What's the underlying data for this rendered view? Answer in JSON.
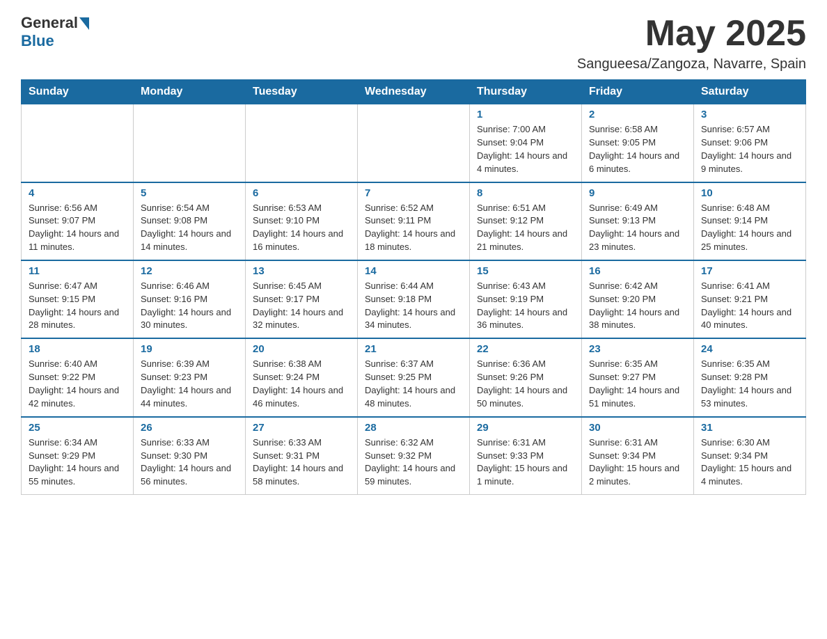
{
  "header": {
    "logo_text": "General",
    "logo_blue": "Blue",
    "title": "May 2025",
    "location": "Sangueesa/Zangoza, Navarre, Spain"
  },
  "days_of_week": [
    "Sunday",
    "Monday",
    "Tuesday",
    "Wednesday",
    "Thursday",
    "Friday",
    "Saturday"
  ],
  "weeks": [
    [
      {
        "day": "",
        "sunrise": "",
        "sunset": "",
        "daylight": ""
      },
      {
        "day": "",
        "sunrise": "",
        "sunset": "",
        "daylight": ""
      },
      {
        "day": "",
        "sunrise": "",
        "sunset": "",
        "daylight": ""
      },
      {
        "day": "",
        "sunrise": "",
        "sunset": "",
        "daylight": ""
      },
      {
        "day": "1",
        "sunrise": "Sunrise: 7:00 AM",
        "sunset": "Sunset: 9:04 PM",
        "daylight": "Daylight: 14 hours and 4 minutes."
      },
      {
        "day": "2",
        "sunrise": "Sunrise: 6:58 AM",
        "sunset": "Sunset: 9:05 PM",
        "daylight": "Daylight: 14 hours and 6 minutes."
      },
      {
        "day": "3",
        "sunrise": "Sunrise: 6:57 AM",
        "sunset": "Sunset: 9:06 PM",
        "daylight": "Daylight: 14 hours and 9 minutes."
      }
    ],
    [
      {
        "day": "4",
        "sunrise": "Sunrise: 6:56 AM",
        "sunset": "Sunset: 9:07 PM",
        "daylight": "Daylight: 14 hours and 11 minutes."
      },
      {
        "day": "5",
        "sunrise": "Sunrise: 6:54 AM",
        "sunset": "Sunset: 9:08 PM",
        "daylight": "Daylight: 14 hours and 14 minutes."
      },
      {
        "day": "6",
        "sunrise": "Sunrise: 6:53 AM",
        "sunset": "Sunset: 9:10 PM",
        "daylight": "Daylight: 14 hours and 16 minutes."
      },
      {
        "day": "7",
        "sunrise": "Sunrise: 6:52 AM",
        "sunset": "Sunset: 9:11 PM",
        "daylight": "Daylight: 14 hours and 18 minutes."
      },
      {
        "day": "8",
        "sunrise": "Sunrise: 6:51 AM",
        "sunset": "Sunset: 9:12 PM",
        "daylight": "Daylight: 14 hours and 21 minutes."
      },
      {
        "day": "9",
        "sunrise": "Sunrise: 6:49 AM",
        "sunset": "Sunset: 9:13 PM",
        "daylight": "Daylight: 14 hours and 23 minutes."
      },
      {
        "day": "10",
        "sunrise": "Sunrise: 6:48 AM",
        "sunset": "Sunset: 9:14 PM",
        "daylight": "Daylight: 14 hours and 25 minutes."
      }
    ],
    [
      {
        "day": "11",
        "sunrise": "Sunrise: 6:47 AM",
        "sunset": "Sunset: 9:15 PM",
        "daylight": "Daylight: 14 hours and 28 minutes."
      },
      {
        "day": "12",
        "sunrise": "Sunrise: 6:46 AM",
        "sunset": "Sunset: 9:16 PM",
        "daylight": "Daylight: 14 hours and 30 minutes."
      },
      {
        "day": "13",
        "sunrise": "Sunrise: 6:45 AM",
        "sunset": "Sunset: 9:17 PM",
        "daylight": "Daylight: 14 hours and 32 minutes."
      },
      {
        "day": "14",
        "sunrise": "Sunrise: 6:44 AM",
        "sunset": "Sunset: 9:18 PM",
        "daylight": "Daylight: 14 hours and 34 minutes."
      },
      {
        "day": "15",
        "sunrise": "Sunrise: 6:43 AM",
        "sunset": "Sunset: 9:19 PM",
        "daylight": "Daylight: 14 hours and 36 minutes."
      },
      {
        "day": "16",
        "sunrise": "Sunrise: 6:42 AM",
        "sunset": "Sunset: 9:20 PM",
        "daylight": "Daylight: 14 hours and 38 minutes."
      },
      {
        "day": "17",
        "sunrise": "Sunrise: 6:41 AM",
        "sunset": "Sunset: 9:21 PM",
        "daylight": "Daylight: 14 hours and 40 minutes."
      }
    ],
    [
      {
        "day": "18",
        "sunrise": "Sunrise: 6:40 AM",
        "sunset": "Sunset: 9:22 PM",
        "daylight": "Daylight: 14 hours and 42 minutes."
      },
      {
        "day": "19",
        "sunrise": "Sunrise: 6:39 AM",
        "sunset": "Sunset: 9:23 PM",
        "daylight": "Daylight: 14 hours and 44 minutes."
      },
      {
        "day": "20",
        "sunrise": "Sunrise: 6:38 AM",
        "sunset": "Sunset: 9:24 PM",
        "daylight": "Daylight: 14 hours and 46 minutes."
      },
      {
        "day": "21",
        "sunrise": "Sunrise: 6:37 AM",
        "sunset": "Sunset: 9:25 PM",
        "daylight": "Daylight: 14 hours and 48 minutes."
      },
      {
        "day": "22",
        "sunrise": "Sunrise: 6:36 AM",
        "sunset": "Sunset: 9:26 PM",
        "daylight": "Daylight: 14 hours and 50 minutes."
      },
      {
        "day": "23",
        "sunrise": "Sunrise: 6:35 AM",
        "sunset": "Sunset: 9:27 PM",
        "daylight": "Daylight: 14 hours and 51 minutes."
      },
      {
        "day": "24",
        "sunrise": "Sunrise: 6:35 AM",
        "sunset": "Sunset: 9:28 PM",
        "daylight": "Daylight: 14 hours and 53 minutes."
      }
    ],
    [
      {
        "day": "25",
        "sunrise": "Sunrise: 6:34 AM",
        "sunset": "Sunset: 9:29 PM",
        "daylight": "Daylight: 14 hours and 55 minutes."
      },
      {
        "day": "26",
        "sunrise": "Sunrise: 6:33 AM",
        "sunset": "Sunset: 9:30 PM",
        "daylight": "Daylight: 14 hours and 56 minutes."
      },
      {
        "day": "27",
        "sunrise": "Sunrise: 6:33 AM",
        "sunset": "Sunset: 9:31 PM",
        "daylight": "Daylight: 14 hours and 58 minutes."
      },
      {
        "day": "28",
        "sunrise": "Sunrise: 6:32 AM",
        "sunset": "Sunset: 9:32 PM",
        "daylight": "Daylight: 14 hours and 59 minutes."
      },
      {
        "day": "29",
        "sunrise": "Sunrise: 6:31 AM",
        "sunset": "Sunset: 9:33 PM",
        "daylight": "Daylight: 15 hours and 1 minute."
      },
      {
        "day": "30",
        "sunrise": "Sunrise: 6:31 AM",
        "sunset": "Sunset: 9:34 PM",
        "daylight": "Daylight: 15 hours and 2 minutes."
      },
      {
        "day": "31",
        "sunrise": "Sunrise: 6:30 AM",
        "sunset": "Sunset: 9:34 PM",
        "daylight": "Daylight: 15 hours and 4 minutes."
      }
    ]
  ]
}
